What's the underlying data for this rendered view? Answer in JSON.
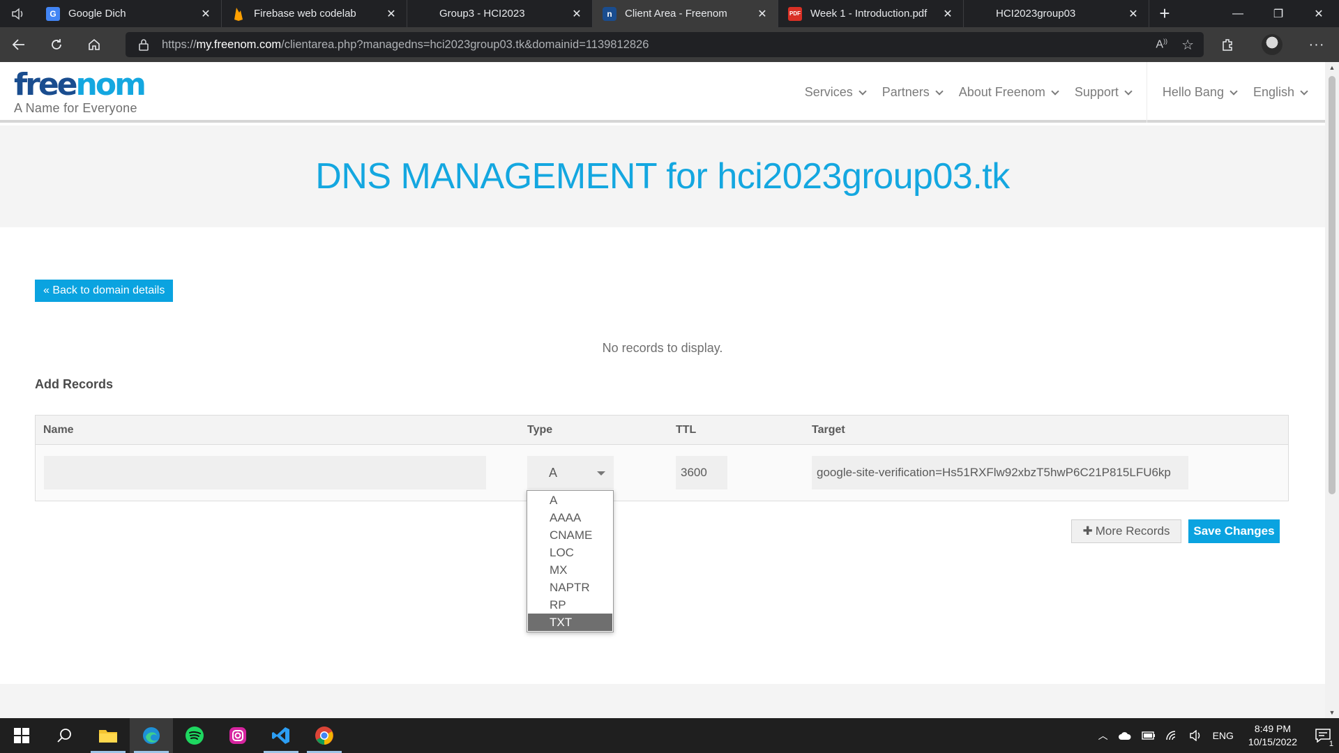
{
  "browser": {
    "tabs": [
      {
        "title": "Google Dich",
        "favicon": "google-translate-icon",
        "color": "#4285f4"
      },
      {
        "title": "Firebase web codelab",
        "favicon": "firebase-icon",
        "color": "#ffa000"
      },
      {
        "title": "Group3 - HCI2023",
        "favicon": "notion-icon",
        "color": "#3b3b3b"
      },
      {
        "title": "Client Area - Freenom",
        "favicon": "freenom-icon",
        "color": "#1a4d8f",
        "active": true
      },
      {
        "title": "Week 1 - Introduction.pdf",
        "favicon": "pdf-icon",
        "color": "#d93025"
      },
      {
        "title": "HCI2023group03",
        "favicon": "notion-icon",
        "color": "#3b3b3b"
      }
    ],
    "url_prefix": "https://",
    "url_host": "my.freenom.com",
    "url_path": "/clientarea.php?managedns=hci2023group03.tk&domainid=1139812826"
  },
  "site": {
    "logo_free": "free",
    "logo_nom": "nom",
    "tagline": "A Name for Everyone",
    "nav": {
      "services": "Services",
      "partners": "Partners",
      "about": "About Freenom",
      "support": "Support",
      "user": "Hello Bang",
      "language": "English"
    }
  },
  "page": {
    "title": "DNS MANAGEMENT for hci2023group03.tk",
    "back_button": "« Back to domain details",
    "no_records": "No records to display.",
    "add_records_heading": "Add Records",
    "table": {
      "headers": {
        "name": "Name",
        "type": "Type",
        "ttl": "TTL",
        "target": "Target"
      },
      "row": {
        "name": "",
        "type": "A",
        "ttl": "3600",
        "target": "google-site-verification=Hs51RXFlw92xbzT5hwP6C21P815LFU6kp"
      }
    },
    "type_options": [
      "A",
      "AAAA",
      "CNAME",
      "LOC",
      "MX",
      "NAPTR",
      "RP",
      "TXT"
    ],
    "highlighted_option": "TXT",
    "more_records_button": "More Records",
    "save_button": "Save Changes"
  },
  "taskbar": {
    "language": "ENG",
    "time": "8:49 PM",
    "date": "10/15/2022",
    "notification_count": "1"
  },
  "colors": {
    "brand_blue": "#14a7e0",
    "brand_dark": "#1a4d8f",
    "button_blue": "#0aa3e0"
  }
}
